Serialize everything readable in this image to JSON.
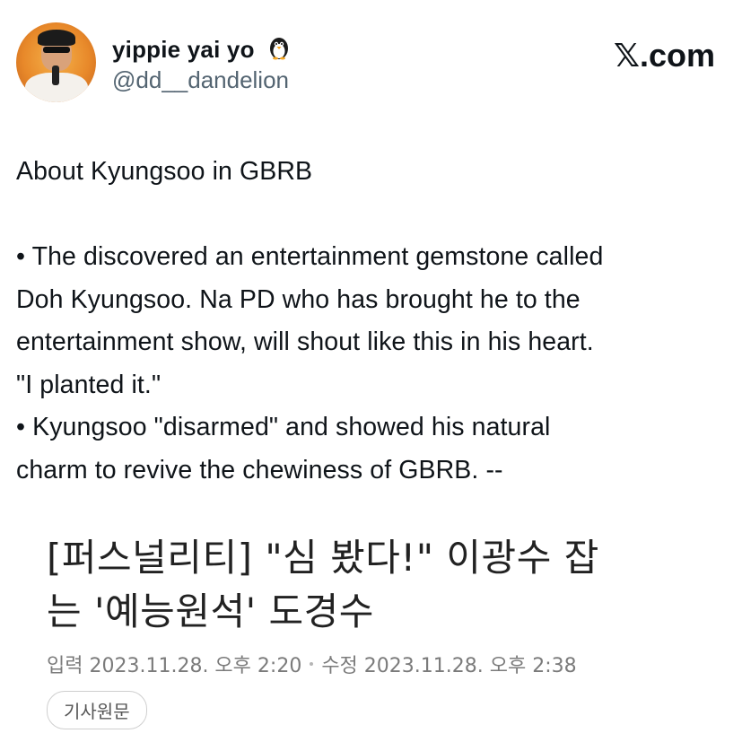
{
  "tweet": {
    "display_name": "yippie yai yo",
    "name_emoji": "penguin-icon",
    "handle": "@dd__dandelion",
    "source_logo": ".com",
    "body": {
      "title": "About Kyungsoo in GBRB",
      "lines": [
        "• The discovered an entertainment gemstone called",
        "Doh Kyungsoo. Na PD who has brought he to the",
        "entertainment show, will shout like this in his heart.",
        "\"I planted it.\"",
        "• Kyungsoo \"disarmed\" and showed his natural",
        "charm to revive the chewiness of GBRB. --"
      ]
    }
  },
  "article": {
    "headline_lines": [
      "[퍼스널리티] \"심 봤다!\" 이광수 잡",
      "는 '예능원석' 도경수"
    ],
    "input_label": "입력",
    "input_date": "2023.11.28. 오후 2:20",
    "edit_label": "수정",
    "edit_date": "2023.11.28. 오후 2:38",
    "original_button": "기사원문"
  },
  "colors": {
    "text": "#0f1419",
    "secondary": "#536471",
    "meta": "#7b7b7b"
  }
}
